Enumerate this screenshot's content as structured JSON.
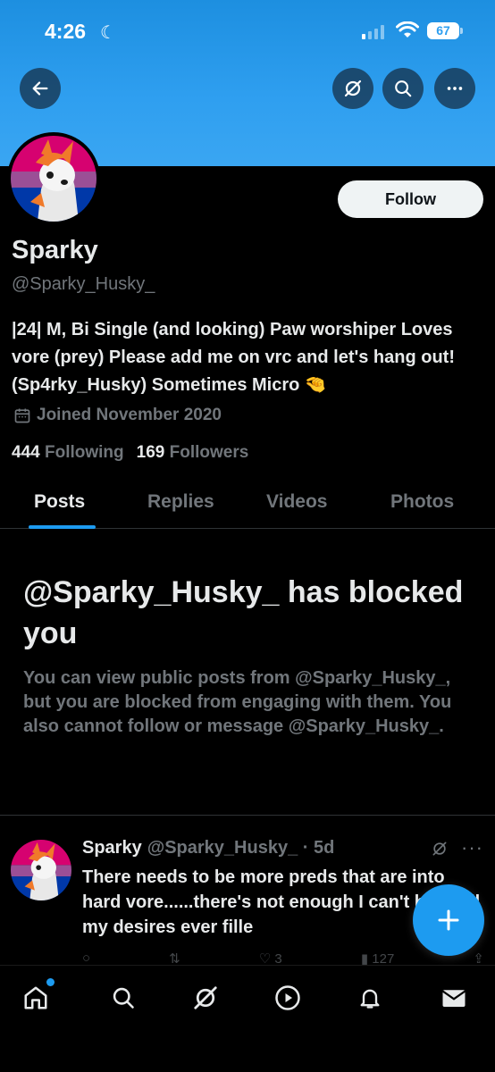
{
  "status_bar": {
    "time": "4:26",
    "battery": "67"
  },
  "header": {
    "back_icon": "arrow-left-icon",
    "grok_icon": "grok-icon",
    "search_icon": "search-icon",
    "more_icon": "more-horizontal-icon"
  },
  "profile": {
    "name": "Sparky",
    "handle": "@Sparky_Husky_",
    "follow_label": "Follow",
    "bio": "|24| M, Bi Single (and looking) Paw worshiper Loves vore (prey) Please add me on vrc and let's hang out! (Sp4rky_Husky) Sometimes Micro 🤏",
    "joined": "Joined November 2020",
    "following_count": "444",
    "following_label": "Following",
    "followers_count": "169",
    "followers_label": "Followers"
  },
  "tabs": [
    {
      "label": "Posts",
      "active": true
    },
    {
      "label": "Replies",
      "active": false
    },
    {
      "label": "Videos",
      "active": false
    },
    {
      "label": "Photos",
      "active": false
    }
  ],
  "blocked": {
    "title": "@Sparky_Husky_ has blocked you",
    "description": "You can view public posts from @Sparky_Husky_, but you are blocked from engaging with them. You also cannot follow or message @Sparky_Husky_."
  },
  "post": {
    "name": "Sparky",
    "handle_time": "@Sparky_Husky_ · 5d",
    "text": "There needs to be more preds that are into hard vore......there's not enough I can't have all my desires ever fille",
    "like_count": "3",
    "view_count": "127"
  },
  "colors": {
    "accent": "#1d9bf0",
    "banner": "#2f9ff0",
    "background": "#000000",
    "muted": "#71767b"
  },
  "bottom_nav": [
    "home-icon",
    "search-icon",
    "grok-icon",
    "video-icon",
    "bell-icon",
    "mail-icon"
  ]
}
